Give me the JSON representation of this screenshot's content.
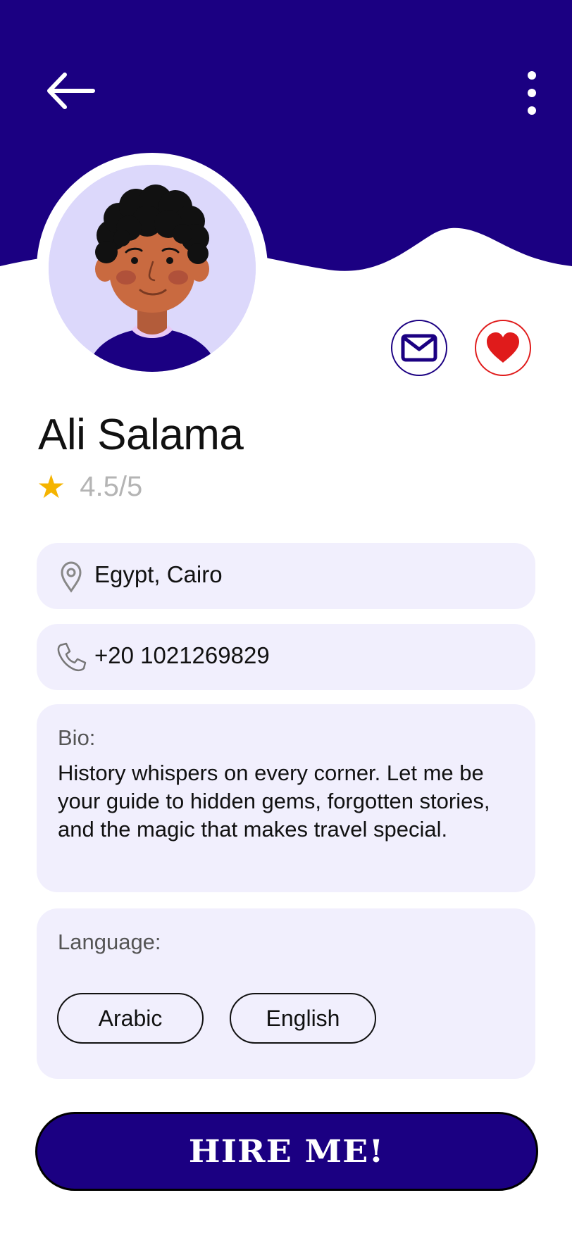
{
  "colors": {
    "header": "#1b0082",
    "accent": "#1b0082",
    "card_bg": "#f1effd",
    "favorite": "#e01b1b",
    "star": "#f5b400",
    "rating_text": "#b4b4b4"
  },
  "header": {
    "back_icon": "arrow-left-icon",
    "menu_icon": "more-vertical-icon"
  },
  "profile": {
    "name": "Ali Salama",
    "rating": "4.5/5",
    "avatar": "avatar-illustration"
  },
  "actions": {
    "message_icon": "mail-icon",
    "favorite_icon": "heart-icon"
  },
  "contact": {
    "location": "Egypt, Cairo",
    "phone": "+20 1021269829"
  },
  "bio": {
    "label": "Bio:",
    "text": "History whispers on every corner. Let me be your guide to hidden gems, forgotten stories, and the magic that makes travel special."
  },
  "languages": {
    "label": "Language:",
    "items": [
      "Arabic",
      "English"
    ]
  },
  "cta": {
    "label": "HIRE ME!"
  }
}
